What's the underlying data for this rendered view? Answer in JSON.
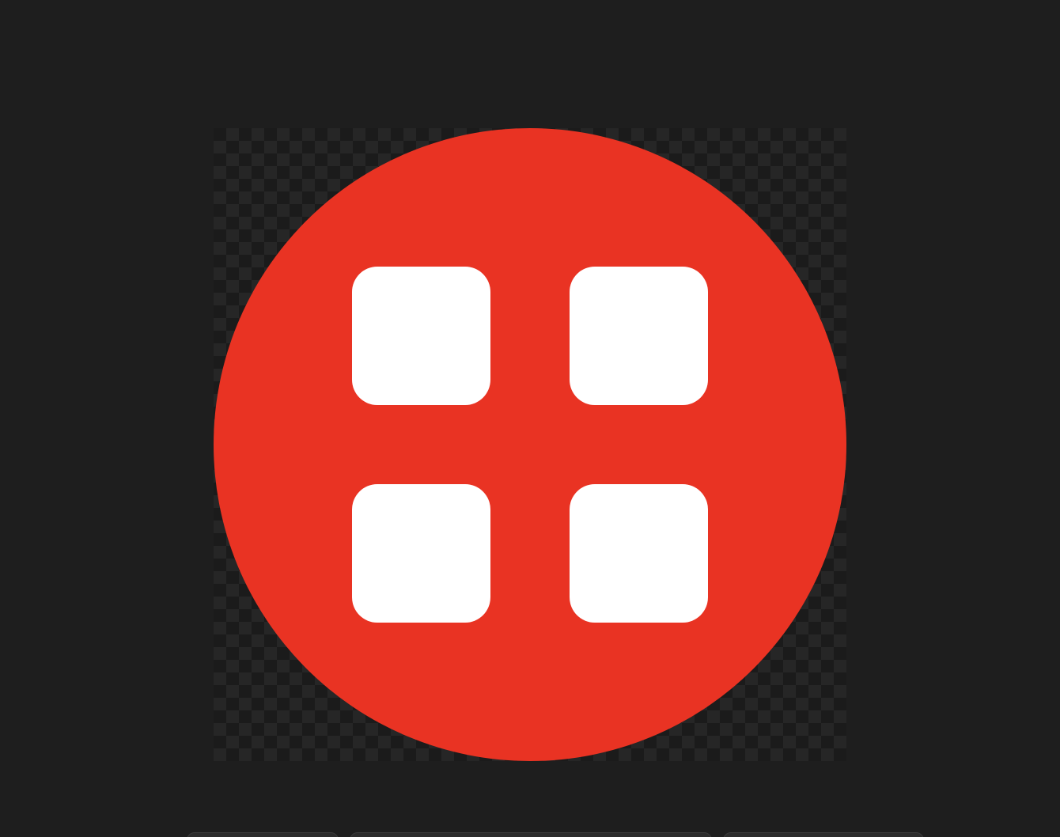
{
  "viewer": {
    "background_color": "#1e1e1e",
    "transparency_pattern": "checkerboard"
  },
  "image": {
    "icon_name": "apps-grid-icon",
    "circle_color": "#e93323",
    "square_color": "#ffffff"
  },
  "toolbar": {
    "buttons": [
      "left-toolbar-button",
      "center-toolbar-button",
      "right-toolbar-button"
    ]
  }
}
